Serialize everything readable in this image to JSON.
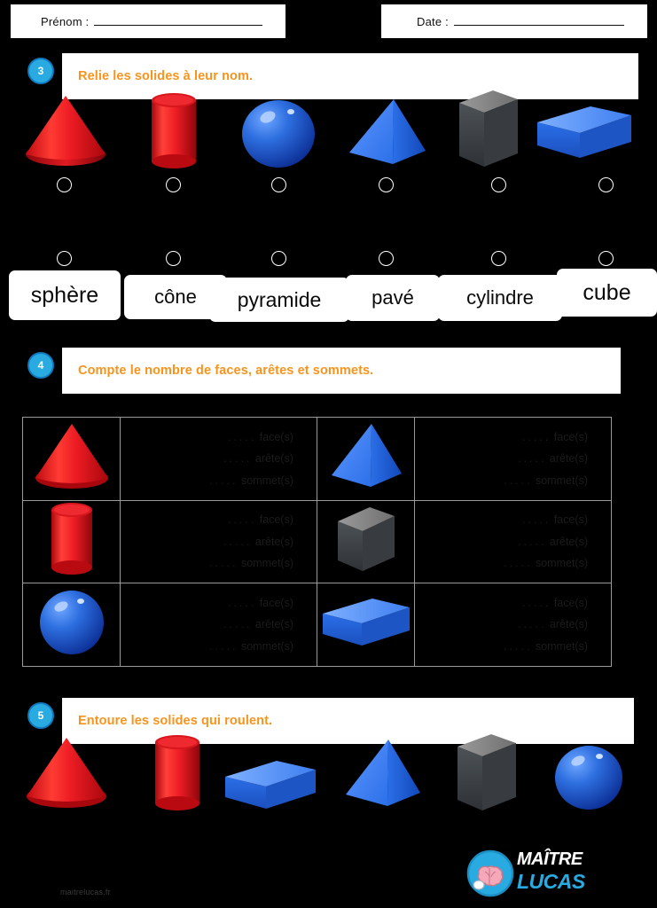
{
  "header": {
    "prenom_label": "Prénom :",
    "date_label": "Date :"
  },
  "exercises": [
    {
      "number": "3",
      "instruction": "Relie les solides à leur nom."
    },
    {
      "number": "4",
      "instruction": "Compte le nombre de faces, arêtes et sommets."
    },
    {
      "number": "5",
      "instruction": "Entoure les solides qui roulent."
    }
  ],
  "exercise3": {
    "top_row_shapes": [
      "cone",
      "cylinder",
      "sphere",
      "pyramid",
      "cube",
      "cuboid"
    ],
    "words": [
      "sphère",
      "cône",
      "pyramide",
      "pavé",
      "cylindre",
      "cube"
    ]
  },
  "exercise4": {
    "labels": {
      "faces": "face(s)",
      "edges": "arête(s)",
      "vertices": "sommet(s)"
    },
    "blank": ".....",
    "rows": [
      {
        "left_shape": "cone",
        "right_shape": "pyramid"
      },
      {
        "left_shape": "cylinder",
        "right_shape": "cube"
      },
      {
        "left_shape": "sphere",
        "right_shape": "cuboid"
      }
    ]
  },
  "exercise5": {
    "shapes": [
      "cone",
      "cylinder",
      "cuboid",
      "pyramid",
      "cube",
      "sphere"
    ]
  },
  "footer": {
    "site": "maitrelucas.fr",
    "logo_line1": "MAÎTRE",
    "logo_line2": "LUCAS"
  },
  "colors": {
    "accent_orange": "#F7941E",
    "badge_blue": "#29ABE2",
    "red": "#ED1C24",
    "blue": "#2B6FE8",
    "dark_gray": "#4A4A4A",
    "background": "#000000",
    "panel": "#FFFFFF"
  }
}
